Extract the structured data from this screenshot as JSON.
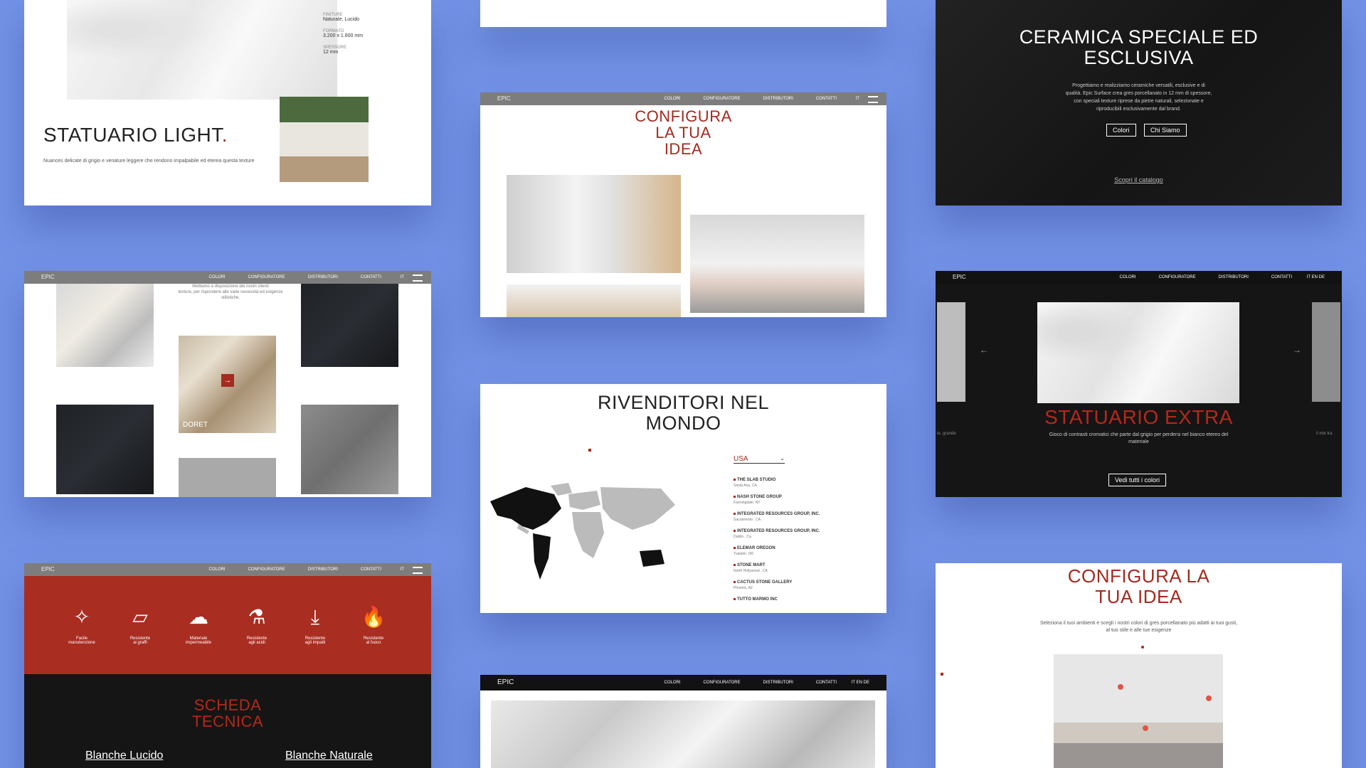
{
  "card1": {
    "title": "STATUARIO LIGHT",
    "title_dot": ".",
    "desc": "Nuances delicate di grigio e venature leggere che rendono impalpabile ed eterea questa texture",
    "spec": [
      {
        "label": "FINITURE",
        "value": "Naturale, Lucido"
      },
      {
        "label": "FORMATO",
        "value": "3.200 x 1.600 mm"
      },
      {
        "label": "SPESSORE",
        "value": "12 mm"
      }
    ]
  },
  "card2": {
    "title_lines": [
      "CONFIGURA",
      "LA TUA",
      "IDEA"
    ]
  },
  "card3": {
    "title_lines": [
      "CERAMICA SPECIALE ED",
      "ESCLUSIVA"
    ],
    "body_lines": [
      "Progettiamo e realizziamo ceramiche versatili, esclusive e di",
      "qualità. Epic Surface crea gres porcellanato in 12 mm di spessore,",
      "con speciali texture riprese da pietre naturali, selezionate e",
      "riproducibili esclusivamente dal brand."
    ],
    "btn_colori": "Colori",
    "btn_chisiamo": "Chi Siamo",
    "link_catalogo": "Scopri il catalogo"
  },
  "nav": {
    "logo": "EPIC",
    "links": [
      "COLORI",
      "CONFIGURATORE",
      "DISTRIBUTORI",
      "CONTATTI"
    ],
    "lang": "IT",
    "lang_multi": "IT  EN  DE"
  },
  "card4": {
    "intro_lines": [
      "Mettiamo a disposizione dei nostri clienti",
      "texture, per rispondere alle varie necessità ed esigenze",
      "stilistiche."
    ],
    "tile_label": "DORET"
  },
  "card5": {
    "title": "RIVENDITORI NEL",
    "title2": "MONDO",
    "country": "USA",
    "dealers": [
      {
        "name": "THE SLAB STUDIO",
        "city": "Santa Ana, CA"
      },
      {
        "name": "NASH STONE GROUP",
        "city": "Farmingdale, NY"
      },
      {
        "name": "INTEGRATED RESOURCES GROUP, INC.",
        "city": "Sacramento , CA"
      },
      {
        "name": "INTEGRATED RESOURCES GROUP, INC.",
        "city": "Dublin , Ca"
      },
      {
        "name": "ELEMAR OREGON",
        "city": "Tualatin, OR"
      },
      {
        "name": "STONE MART",
        "city": "North Hollywood , CA"
      },
      {
        "name": "CACTUS STONE GALLERY",
        "city": "Phoenix, AZ"
      },
      {
        "name": "TUTTO MARMO INC",
        "city": ""
      }
    ]
  },
  "card6": {
    "title": "STATUARIO EXTRA",
    "desc_lines": [
      "Gioco di contrasti cromatici che parte dal grigio per perdersi nel bianco etereo del",
      "materiale"
    ],
    "left_frag": "ie, grande",
    "right_frag": "il mix tra",
    "btn": "Vedi tutti i colori"
  },
  "card7": {
    "features": [
      {
        "icon": "sparkle-icon",
        "glyph": "✧",
        "label1": "Facile",
        "label2": "manutenzione"
      },
      {
        "icon": "scratch-icon",
        "glyph": "▱",
        "label1": "Resistente",
        "label2": "ai graffi"
      },
      {
        "icon": "cloud-rain-icon",
        "glyph": "☁",
        "label1": "Materiale",
        "label2": "impermeabile"
      },
      {
        "icon": "flask-icon",
        "glyph": "⚗",
        "label1": "Resistente",
        "label2": "agli acidi"
      },
      {
        "icon": "impact-icon",
        "glyph": "⤓",
        "label1": "Resistente",
        "label2": "agli impatti"
      },
      {
        "icon": "flame-icon",
        "glyph": "🔥",
        "label1": "Resistente",
        "label2": "al fuoco"
      }
    ],
    "scheda_lines": [
      "SCHEDA",
      "TECNICA"
    ],
    "link1": "Blanche Lucido",
    "link2": "Blanche Naturale"
  },
  "card9": {
    "title_lines": [
      "CONFIGURA LA",
      "TUA IDEA"
    ],
    "desc_lines": [
      "Seleziona il tuoi ambienti e scegli i nostri colori di gres porcellanato più adatti ai tuoi gusti,",
      "al tuo stile e alle tue esigenze"
    ]
  },
  "colors": {
    "background": "#7392e6",
    "brand_red": "#a52a1f",
    "dark": "#151515"
  }
}
